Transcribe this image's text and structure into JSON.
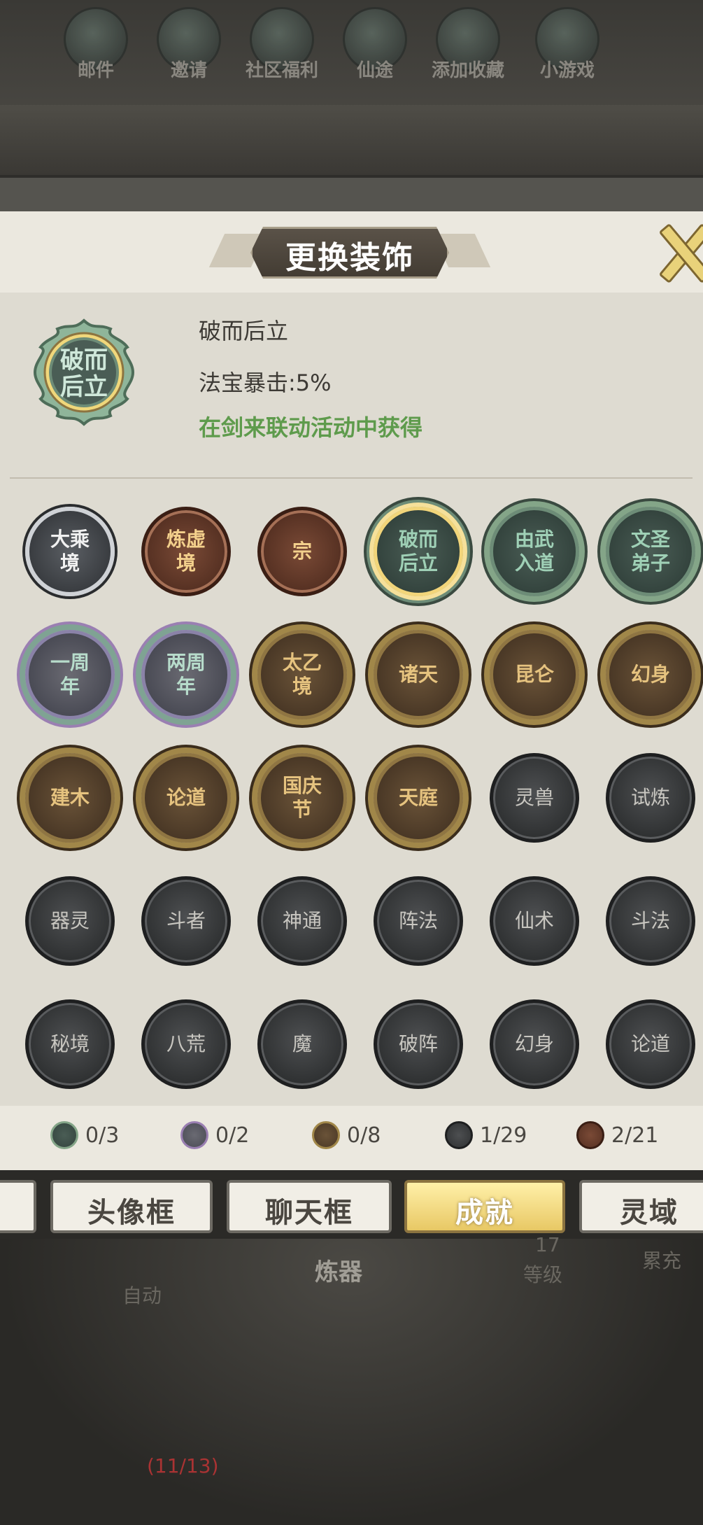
{
  "background": {
    "top_buttons": [
      {
        "label": "邮件",
        "icon": "mail-icon"
      },
      {
        "label": "邀请",
        "icon": "invite-icon"
      },
      {
        "label": "社区福利",
        "icon": "community-icon"
      },
      {
        "label": "仙途",
        "icon": "path-icon"
      },
      {
        "label": "添加收藏",
        "icon": "favorite-icon"
      },
      {
        "label": "小游戏",
        "icon": "minigame-icon"
      }
    ],
    "bottom": {
      "refine_label": "炼器",
      "auto_label": "自动",
      "level_value": "17",
      "level_label": "等级",
      "side_text": "累充",
      "progress": "(11/13)"
    }
  },
  "dialog": {
    "title": "更换装饰",
    "selected": {
      "badge_text": "破而后立",
      "name": "破而后立",
      "attribute": "法宝暴击:5%",
      "source": "在剑来联动活动中获得"
    },
    "badges": [
      {
        "label": "大乘境",
        "tier": "white"
      },
      {
        "label": "炼虚境",
        "tier": "brown"
      },
      {
        "label": "宗",
        "tier": "brown"
      },
      {
        "label": "破而后立",
        "tier": "jade",
        "selected": true
      },
      {
        "label": "由武入道",
        "tier": "jade"
      },
      {
        "label": "文圣弟子",
        "tier": "jade"
      },
      {
        "label": "一周年",
        "tier": "holo"
      },
      {
        "label": "两周年",
        "tier": "holo"
      },
      {
        "label": "太乙境",
        "tier": "gold"
      },
      {
        "label": "诸天",
        "tier": "gold"
      },
      {
        "label": "昆仑",
        "tier": "gold"
      },
      {
        "label": "幻身",
        "tier": "gold"
      },
      {
        "label": "建木",
        "tier": "gold"
      },
      {
        "label": "论道",
        "tier": "gold"
      },
      {
        "label": "国庆节",
        "tier": "gold"
      },
      {
        "label": "天庭",
        "tier": "gold"
      },
      {
        "label": "灵兽",
        "tier": "lock"
      },
      {
        "label": "试炼",
        "tier": "lock"
      },
      {
        "label": "器灵",
        "tier": "lock"
      },
      {
        "label": "斗者",
        "tier": "lock"
      },
      {
        "label": "神通",
        "tier": "lock"
      },
      {
        "label": "阵法",
        "tier": "lock"
      },
      {
        "label": "仙术",
        "tier": "lock"
      },
      {
        "label": "斗法",
        "tier": "lock"
      },
      {
        "label": "秘境",
        "tier": "lock"
      },
      {
        "label": "八荒",
        "tier": "lock"
      },
      {
        "label": "魔",
        "tier": "lock"
      },
      {
        "label": "破阵",
        "tier": "lock"
      },
      {
        "label": "幻身",
        "tier": "lock"
      },
      {
        "label": "论道",
        "tier": "lock"
      }
    ],
    "counters": [
      {
        "tier": "jade",
        "value": "0/3"
      },
      {
        "tier": "holo",
        "value": "0/2"
      },
      {
        "tier": "gold",
        "value": "0/8"
      },
      {
        "tier": "lock",
        "value": "1/29"
      },
      {
        "tier": "brown",
        "value": "2/21"
      }
    ]
  },
  "tabs": [
    {
      "label": "头像框",
      "active": false
    },
    {
      "label": "聊天框",
      "active": false
    },
    {
      "label": "成就",
      "active": true
    },
    {
      "label": "灵域",
      "active": false
    }
  ],
  "colors": {
    "panel_bg": "#ebe8df",
    "source_green": "#5e9b4c",
    "active_tab": "#e8c865"
  }
}
